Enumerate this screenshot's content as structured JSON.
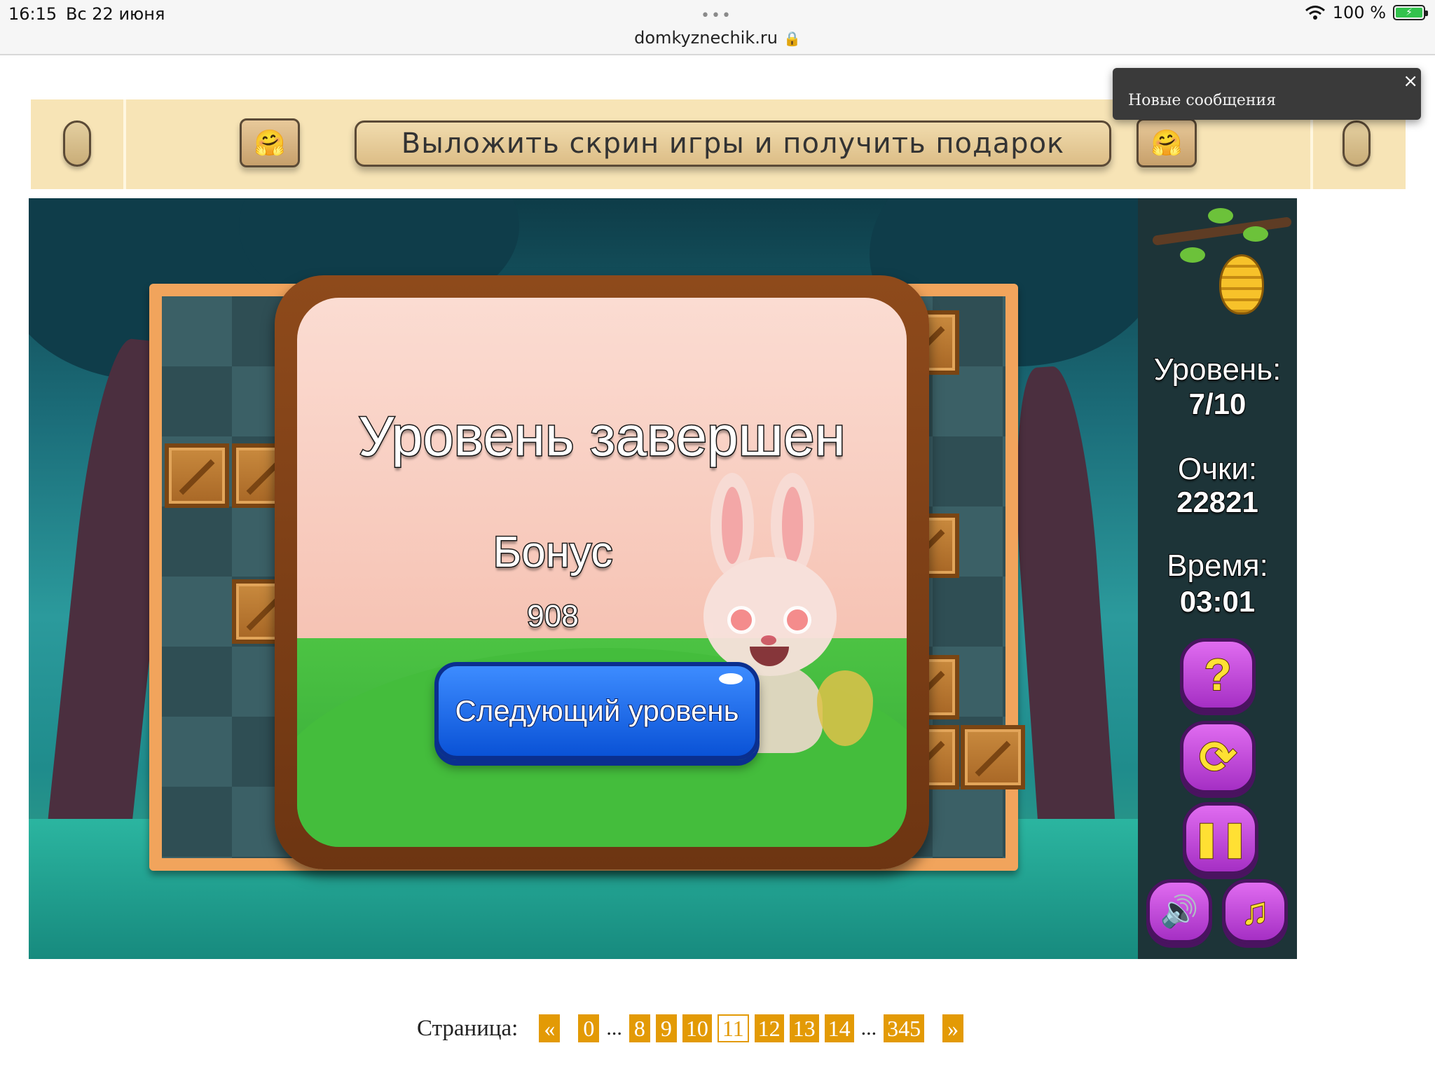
{
  "status_bar": {
    "time": "16:15",
    "date": "Вс 22 июня",
    "url": "domkyznechik.ru",
    "battery": "100 %"
  },
  "banner": {
    "cta_label": "Выложить скрин игры и получить подарок",
    "emoji": "🤗"
  },
  "toast": {
    "text": "Новые сообщения",
    "close": "×"
  },
  "game": {
    "dialog": {
      "title": "Уровень завершен",
      "bonus_label": "Бонус",
      "bonus_value": "908",
      "next_button": "Следующий уровень"
    },
    "sidebar": {
      "level_label": "Уровень:",
      "level_value": "7/10",
      "score_label": "Очки:",
      "score_value": "22821",
      "time_label": "Время:",
      "time_value": "03:01",
      "help_glyph": "?",
      "restart_glyph": "⟳",
      "pause_glyph": "❚❚",
      "sound_glyph": "🔊",
      "music_glyph": "♫"
    }
  },
  "pagination": {
    "label": "Страница:",
    "prev": "«",
    "next": "»",
    "ellipsis": "...",
    "pages": [
      "0",
      "8",
      "9",
      "10",
      "11",
      "12",
      "13",
      "14",
      "345"
    ],
    "current": "11"
  },
  "colors": {
    "accent_orange": "#e39a05",
    "banner_bg": "#f7e4b6",
    "next_button_blue": "#0a52d6",
    "game_button_purple": "#a52fc4"
  }
}
